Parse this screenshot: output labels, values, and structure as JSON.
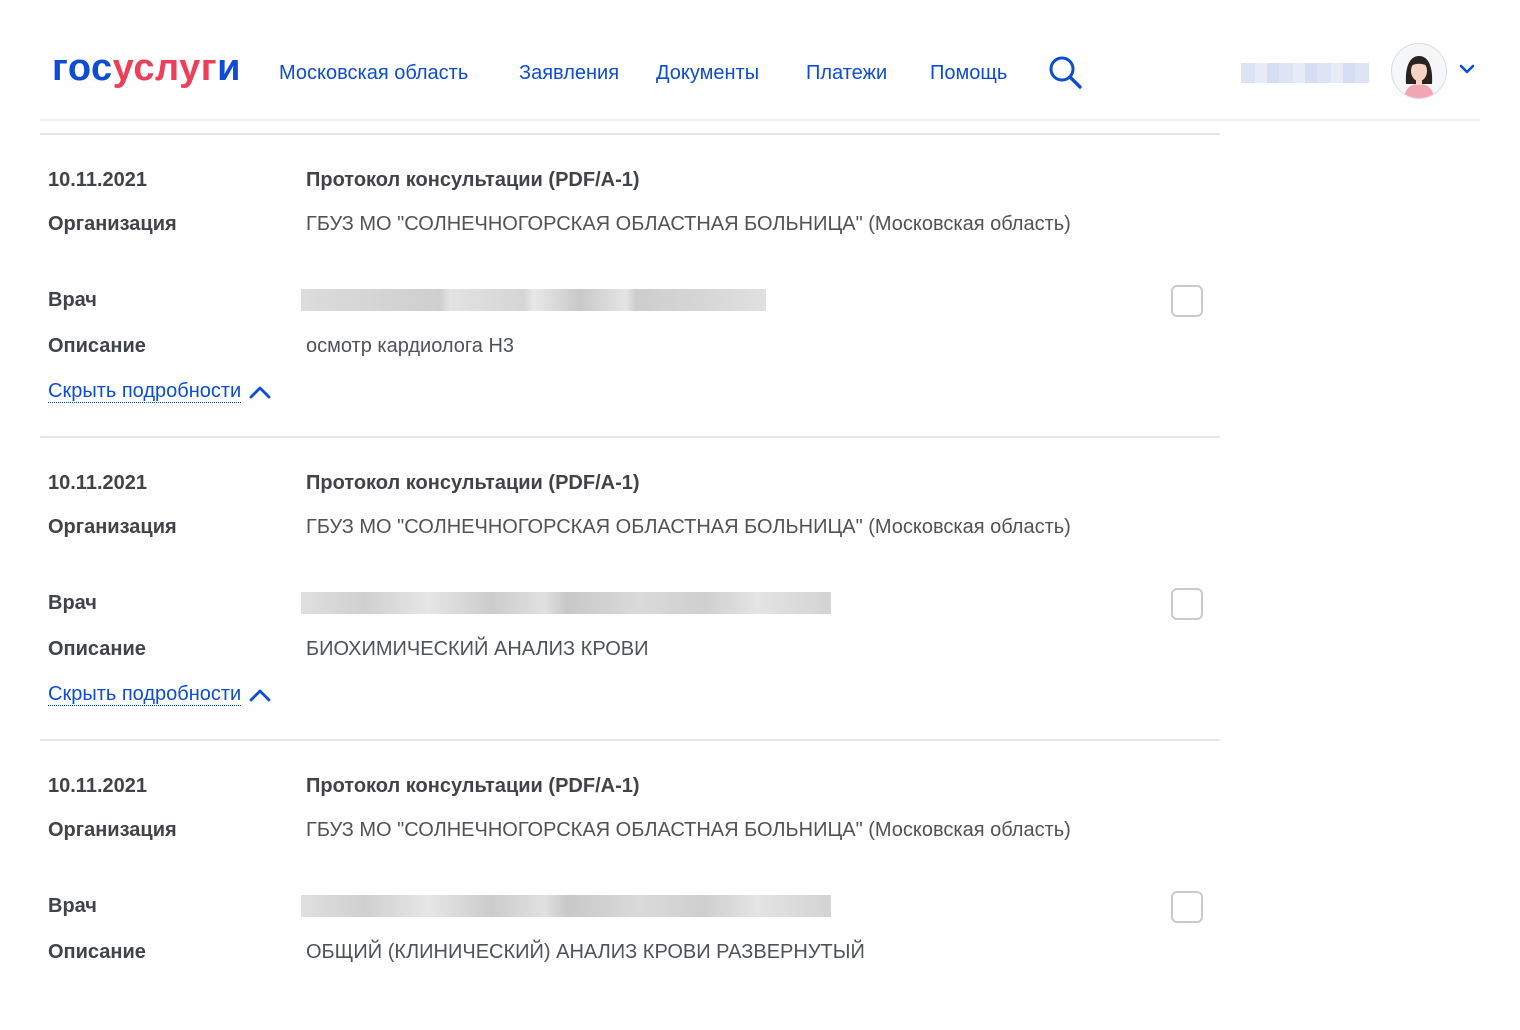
{
  "header": {
    "logo": {
      "part1": "гос",
      "part2": "услуг",
      "part3": "и"
    },
    "nav": [
      {
        "label": "Московская область"
      },
      {
        "label": "Заявления"
      },
      {
        "label": "Документы"
      },
      {
        "label": "Платежи"
      },
      {
        "label": "Помощь"
      }
    ],
    "icons": {
      "search": "search-icon",
      "avatar": "avatar-icon",
      "menu": "chevron-down-icon"
    }
  },
  "labels": {
    "organization": "Организация",
    "doctor": "Врач",
    "description": "Описание",
    "hide_details": "Скрыть подробности"
  },
  "records": [
    {
      "date": "10.11.2021",
      "title": "Протокол консультации (PDF/A-1)",
      "organization": "ГБУЗ МО \"СОЛНЕЧНОГОРСКАЯ ОБЛАСТНАЯ БОЛЬНИЦА\" (Московская область)",
      "description": "осмотр кардиолога Н3"
    },
    {
      "date": "10.11.2021",
      "title": "Протокол консультации (PDF/A-1)",
      "organization": "ГБУЗ МО \"СОЛНЕЧНОГОРСКАЯ ОБЛАСТНАЯ БОЛЬНИЦА\" (Московская область)",
      "description": "БИОХИМИЧЕСКИЙ АНАЛИЗ КРОВИ"
    },
    {
      "date": "10.11.2021",
      "title": "Протокол консультации (PDF/A-1)",
      "organization": "ГБУЗ МО \"СОЛНЕЧНОГОРСКАЯ ОБЛАСТНАЯ БОЛЬНИЦА\" (Московская область)",
      "description": "ОБЩИЙ (КЛИНИЧЕСКИЙ) АНАЛИЗ КРОВИ РАЗВЕРНУТЫЙ"
    }
  ],
  "colors": {
    "brand_blue": "#0d4cd3",
    "brand_red": "#ee3f58"
  }
}
